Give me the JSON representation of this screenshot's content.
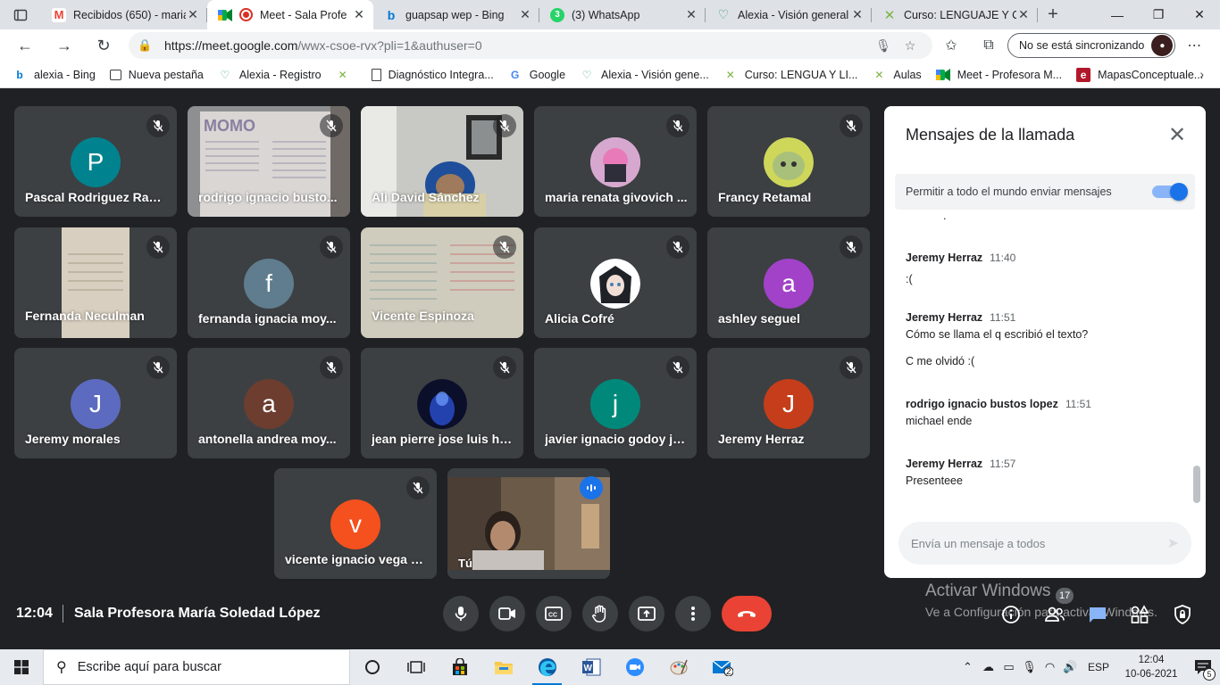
{
  "browser": {
    "tabs": [
      {
        "label": "Recibidos (650) - maria",
        "icon": "gmail-icon",
        "color": "#ea4335"
      },
      {
        "label": "Meet - Sala Profe",
        "icon": "meet-icon",
        "color": "#00832d"
      },
      {
        "label": "guapsap wep - Bing",
        "icon": "bing-icon",
        "color": "#0078d4"
      },
      {
        "label": "(3) WhatsApp",
        "icon": "whatsapp-icon",
        "color": "#25d366"
      },
      {
        "label": "Alexia - Visión general",
        "icon": "leaf-icon",
        "color": "#3ea37a"
      },
      {
        "label": "Curso: LENGUAJE Y CO",
        "icon": "x-logo-icon",
        "color": "#8bc34a"
      }
    ],
    "url_host": "https://meet.google.com",
    "url_path": "/wwx-csoe-rvx?pli=1&authuser=0",
    "profile_label": "No se está sincronizando",
    "bookmarks": [
      {
        "label": "alexia - Bing",
        "icon": "bing-icon"
      },
      {
        "label": "Nueva pestaña",
        "icon": "newtab-icon"
      },
      {
        "label": "Alexia - Registro",
        "icon": "leaf-icon"
      },
      {
        "label": "",
        "icon": "x-logo-icon"
      },
      {
        "label": "Diagnóstico Integra...",
        "icon": "page-icon"
      },
      {
        "label": "Google",
        "icon": "google-icon"
      },
      {
        "label": "Alexia - Visión gene...",
        "icon": "leaf-icon"
      },
      {
        "label": "Curso: LENGUA Y LI...",
        "icon": "x-logo-icon"
      },
      {
        "label": "Aulas",
        "icon": "x-logo-icon"
      },
      {
        "label": "Meet - Profesora M...",
        "icon": "meet-icon"
      },
      {
        "label": "MapasConceptuale...",
        "icon": "e-icon"
      }
    ]
  },
  "participants": [
    {
      "name": "Pascal Rodriguez Rave...",
      "initial": "P",
      "color": "#00838f",
      "kind": "avatar"
    },
    {
      "name": "rodrigo ignacio busto...",
      "initial": "",
      "color": "#8a8a8a",
      "kind": "video-paper"
    },
    {
      "name": "Ali David Sánchez",
      "initial": "",
      "color": "#6d7c85",
      "kind": "video-room"
    },
    {
      "name": "maria renata givovich ...",
      "initial": "",
      "color": "#c56ab0",
      "kind": "photo"
    },
    {
      "name": "Francy Retamal",
      "initial": "",
      "color": "#c9d24a",
      "kind": "photo"
    },
    {
      "name": "Fernanda Neculman",
      "initial": "",
      "color": "#c6bba8",
      "kind": "video-narrow"
    },
    {
      "name": "fernanda ignacia moy...",
      "initial": "f",
      "color": "#5f7d8e",
      "kind": "avatar"
    },
    {
      "name": "Vicente Espinoza",
      "initial": "",
      "color": "#d2cfc0",
      "kind": "video-notebook"
    },
    {
      "name": "Alicia Cofré",
      "initial": "",
      "color": "#ffffff",
      "kind": "photo"
    },
    {
      "name": "ashley seguel",
      "initial": "a",
      "color": "#a142c8",
      "kind": "avatar"
    },
    {
      "name": "Jeremy morales",
      "initial": "J",
      "color": "#5c6bc0",
      "kind": "avatar"
    },
    {
      "name": "antonella andrea moy...",
      "initial": "a",
      "color": "#6d3d30",
      "kind": "avatar"
    },
    {
      "name": "jean pierre jose luis he...",
      "initial": "",
      "color": "#1a237e",
      "kind": "photo"
    },
    {
      "name": "javier ignacio godoy ja...",
      "initial": "j",
      "color": "#00897b",
      "kind": "avatar"
    },
    {
      "name": "Jeremy Herraz",
      "initial": "J",
      "color": "#c53d1a",
      "kind": "avatar"
    },
    {
      "name": "vicente ignacio vega g...",
      "initial": "v",
      "color": "#f4511e",
      "kind": "avatar"
    },
    {
      "name": "Tú",
      "initial": "",
      "color": "#5a4a3a",
      "kind": "self"
    }
  ],
  "chat": {
    "title": "Mensajes de la llamada",
    "allow_label": "Permitir a todo el mundo enviar mensajes",
    "allow_on": true,
    "partial_text": ".",
    "messages": [
      {
        "sender": "Jeremy Herraz",
        "time": "11:40",
        "lines": [
          ":("
        ]
      },
      {
        "sender": "Jeremy Herraz",
        "time": "11:51",
        "lines": [
          "Cómo se llama el q escribió el texto?",
          "C me olvidó :("
        ]
      },
      {
        "sender": "rodrigo ignacio bustos lopez",
        "time": "11:51",
        "lines": [
          "michael ende"
        ]
      },
      {
        "sender": "Jeremy Herraz",
        "time": "11:57",
        "lines": [
          "Presenteee"
        ]
      }
    ],
    "input_placeholder": "Envía un mensaje a todos"
  },
  "meeting": {
    "time": "12:04",
    "room": "Sala Profesora María Soledad López",
    "participant_count": "17"
  },
  "watermark": {
    "line1": "Activar Windows",
    "line2": "Ve a Configuración para activar Windows."
  },
  "taskbar": {
    "search_placeholder": "Escribe aquí para buscar",
    "lang": "ESP",
    "time": "12:04",
    "date": "10-06-2021",
    "notif_count": "5",
    "mail_badge": "2"
  },
  "colors": {
    "meet_bg": "#202124",
    "tile_bg": "#3c4043",
    "end_call": "#ea4335",
    "accent": "#1a73e8"
  }
}
